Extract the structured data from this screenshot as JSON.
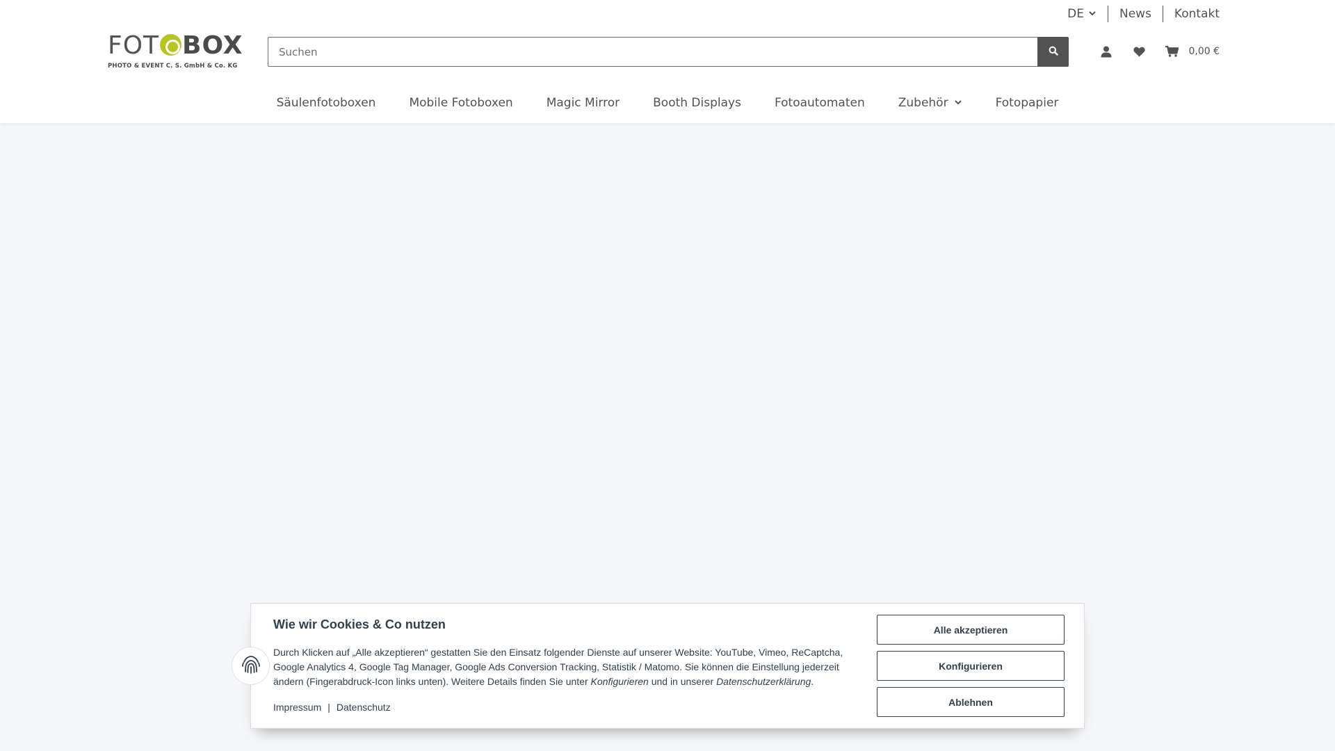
{
  "topbar": {
    "language": "DE",
    "links": [
      "News",
      "Kontakt"
    ]
  },
  "logo": {
    "word_light": "FOT",
    "word_bold": "BOX",
    "subtitle": "PHOTO & EVENT C. S. GmbH & Co. KG"
  },
  "search": {
    "placeholder": "Suchen"
  },
  "header": {
    "cart_total": "0,00 €"
  },
  "nav": {
    "items": [
      "Säulenfotoboxen",
      "Mobile Fotoboxen",
      "Magic Mirror",
      "Booth Displays",
      "Fotoautomaten",
      "Zubehör",
      "Fotopapier"
    ]
  },
  "cookie": {
    "title": "Wie wir Cookies & Co nutzen",
    "text_part1": "Durch Klicken auf „Alle akzeptieren“ gestatten Sie den Einsatz folgender Dienste auf unserer Website: YouTube, Vimeo, ReCaptcha, Google Analytics 4, Google Tag Manager, Google Ads Conversion Tracking, Statistik / Matomo. Sie können die Einstellung jederzeit ändern (Fingerabdruck-Icon links unten). Weitere Details finden Sie unter ",
    "text_em1": "Konfigurieren",
    "text_part2": " und in unserer ",
    "text_em2": "Datenschutzerklärung",
    "text_part3": ".",
    "link_impressum": "Impressum",
    "link_sep": "|",
    "link_datenschutz": "Datenschutz",
    "btn_accept": "Alle akzeptieren",
    "btn_configure": "Konfigurieren",
    "btn_reject": "Ablehnen"
  },
  "colors": {
    "accent_logo": "#b8c520",
    "text": "#525252",
    "cookie_text": "#31414f",
    "page_bg": "#f5f7fa"
  },
  "icons": [
    "chevron-down-icon",
    "search-icon",
    "user-icon",
    "heart-icon",
    "cart-icon",
    "fingerprint-icon"
  ]
}
